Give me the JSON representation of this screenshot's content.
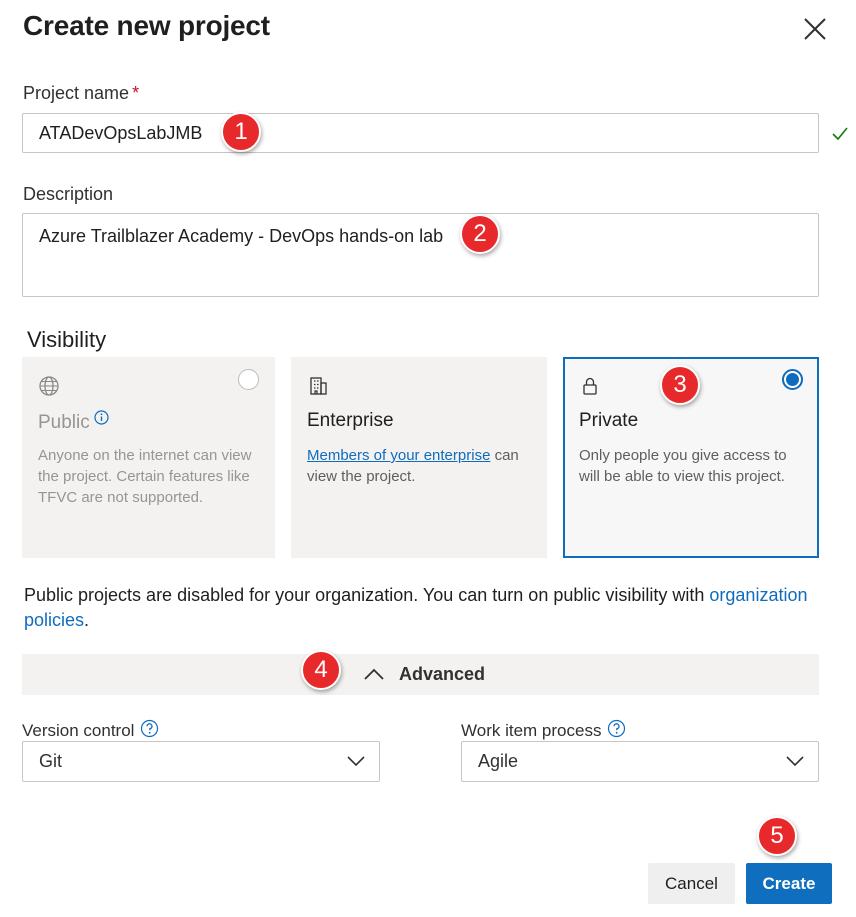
{
  "dialog": {
    "title": "Create new project",
    "close_icon": "close-icon"
  },
  "project_name": {
    "label": "Project name",
    "required_marker": "*",
    "value": "ATADevOpsLabJMB",
    "valid_icon": "checkmark-icon"
  },
  "description": {
    "label": "Description",
    "value": "Azure Trailblazer Academy - DevOps hands-on lab"
  },
  "visibility": {
    "label": "Visibility",
    "selected": "Private",
    "options": [
      {
        "icon": "globe-icon",
        "title": "Public",
        "description": "Anyone on the internet can view the project. Certain features like TFVC are not supported.",
        "disabled": true,
        "checked": false
      },
      {
        "icon": "building-icon",
        "title": "Enterprise",
        "link_text": "Members of your enterprise",
        "description": "can view the project.",
        "disabled": false,
        "checked": false
      },
      {
        "icon": "lock-icon",
        "title": "Private",
        "description": "Only people you give access to will be able to view this project.",
        "disabled": false,
        "checked": true
      }
    ]
  },
  "notice": {
    "text": "Public projects are disabled for your organization. You can turn on public visibility with",
    "link_text": "organization policies",
    "suffix": "."
  },
  "advanced": {
    "label": "Advanced",
    "expanded": true
  },
  "version_control": {
    "label": "Version control",
    "value": "Git"
  },
  "work_item_process": {
    "label": "Work item process",
    "value": "Agile"
  },
  "buttons": {
    "cancel": "Cancel",
    "create": "Create"
  },
  "callouts": [
    "1",
    "2",
    "3",
    "4",
    "5"
  ],
  "colors": {
    "accent": "#0f6cbd",
    "primary_button": "#106ebe",
    "callout": "#e8292c",
    "required": "#c50f1f",
    "valid": "#107c10"
  }
}
